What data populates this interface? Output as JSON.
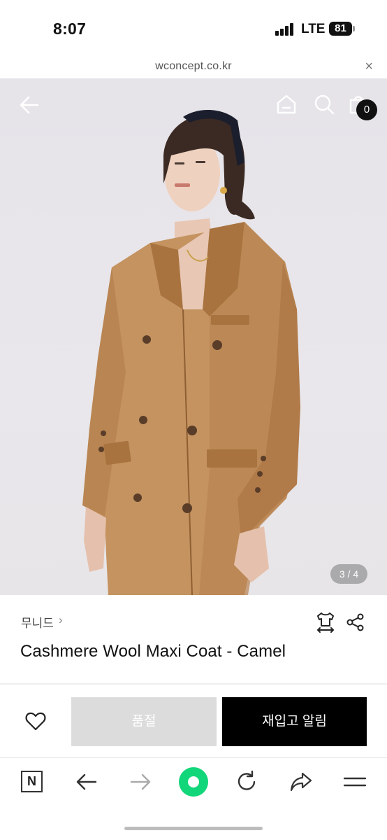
{
  "status_bar": {
    "time": "8:07",
    "network": "LTE",
    "battery": "81"
  },
  "url_bar": {
    "url": "wconcept.co.kr",
    "close_glyph": "×"
  },
  "hero": {
    "page_counter": "3 / 4",
    "cart_count": "0"
  },
  "product": {
    "brand": "무니드",
    "brand_chevron": "›",
    "name": "Cashmere Wool Maxi Coat - Camel"
  },
  "actions": {
    "soldout_label": "품절",
    "restock_label": "재입고 알림"
  },
  "toolbar": {
    "n_label": "N"
  },
  "colors": {
    "accent_green": "#12d67a",
    "coat_camel": "#c49360",
    "soldout_gray": "#dcdcdc"
  },
  "icons": [
    "back-arrow-icon",
    "home-icon",
    "search-icon",
    "shopping-bag-icon",
    "size-guide-icon",
    "share-icon",
    "heart-icon",
    "naver-n-icon",
    "browser-back-icon",
    "browser-forward-icon",
    "green-dot-icon",
    "reload-icon",
    "forward-share-icon",
    "menu-icon"
  ]
}
